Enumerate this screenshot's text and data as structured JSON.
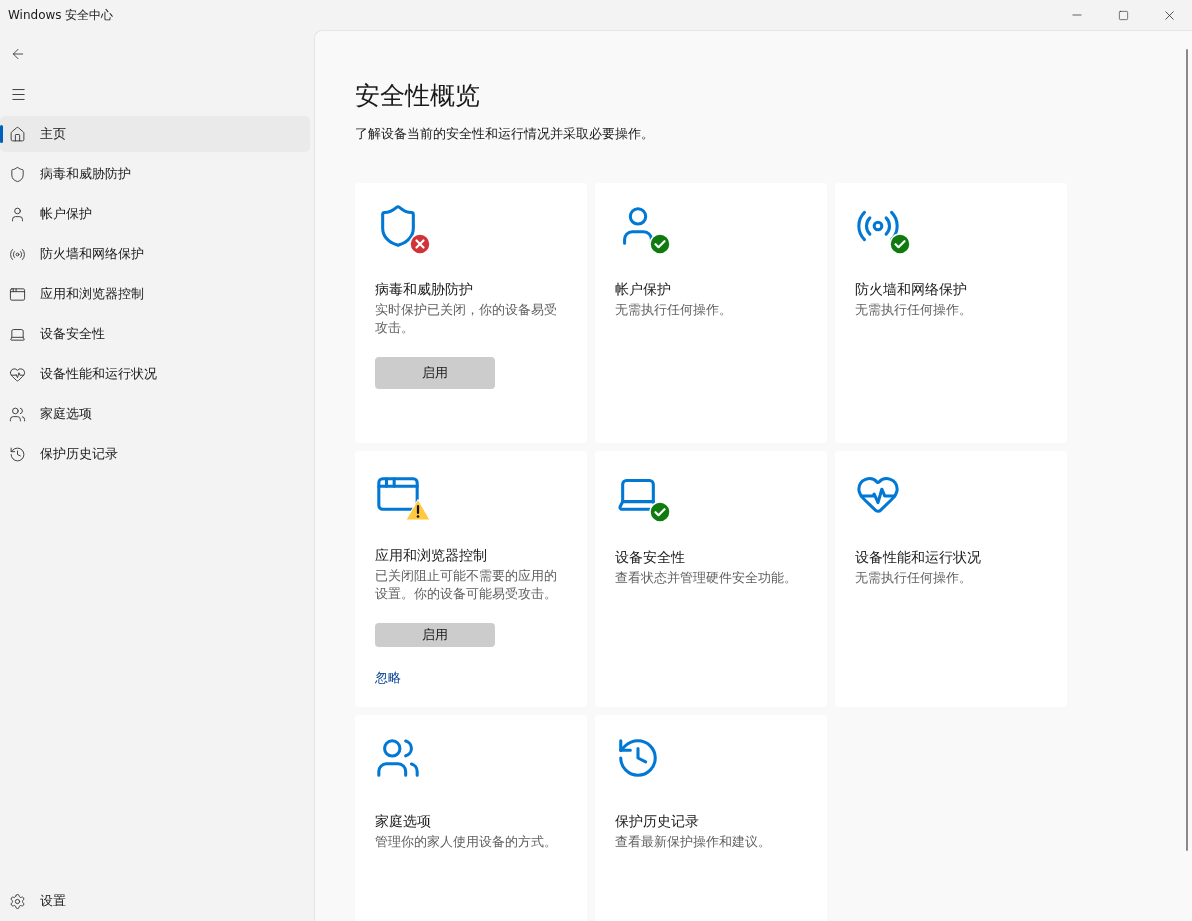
{
  "window": {
    "title": "Windows 安全中心"
  },
  "sidebar": {
    "items": [
      {
        "label": "主页",
        "selected": true
      },
      {
        "label": "病毒和威胁防护",
        "selected": false
      },
      {
        "label": "帐户保护",
        "selected": false
      },
      {
        "label": "防火墙和网络保护",
        "selected": false
      },
      {
        "label": "应用和浏览器控制",
        "selected": false
      },
      {
        "label": "设备安全性",
        "selected": false
      },
      {
        "label": "设备性能和运行状况",
        "selected": false
      },
      {
        "label": "家庭选项",
        "selected": false
      },
      {
        "label": "保护历史记录",
        "selected": false
      }
    ],
    "settings": {
      "label": "设置"
    }
  },
  "page": {
    "title": "安全性概览",
    "subtitle": "了解设备当前的安全性和运行情况并采取必要操作。"
  },
  "cards": [
    {
      "kind": "error",
      "title": "病毒和威胁防护",
      "description": "实时保护已关闭，你的设备易受攻击。",
      "button": "启用"
    },
    {
      "kind": "ok",
      "title": "帐户保护",
      "description": "无需执行任何操作。"
    },
    {
      "kind": "ok",
      "title": "防火墙和网络保护",
      "description": "无需执行任何操作。"
    },
    {
      "kind": "warning",
      "title": "应用和浏览器控制",
      "description": "已关闭阻止可能不需要的应用的设置。你的设备可能易受攻击。",
      "button": "启用",
      "link": "忽略"
    },
    {
      "kind": "ok",
      "title": "设备安全性",
      "description": "查看状态并管理硬件安全功能。"
    },
    {
      "kind": "plain",
      "title": "设备性能和运行状况",
      "description": "无需执行任何操作。"
    },
    {
      "kind": "plain",
      "title": "家庭选项",
      "description": "管理你的家人使用设备的方式。"
    },
    {
      "kind": "plain",
      "title": "保护历史记录",
      "description": "查看最新保护操作和建议。"
    }
  ]
}
